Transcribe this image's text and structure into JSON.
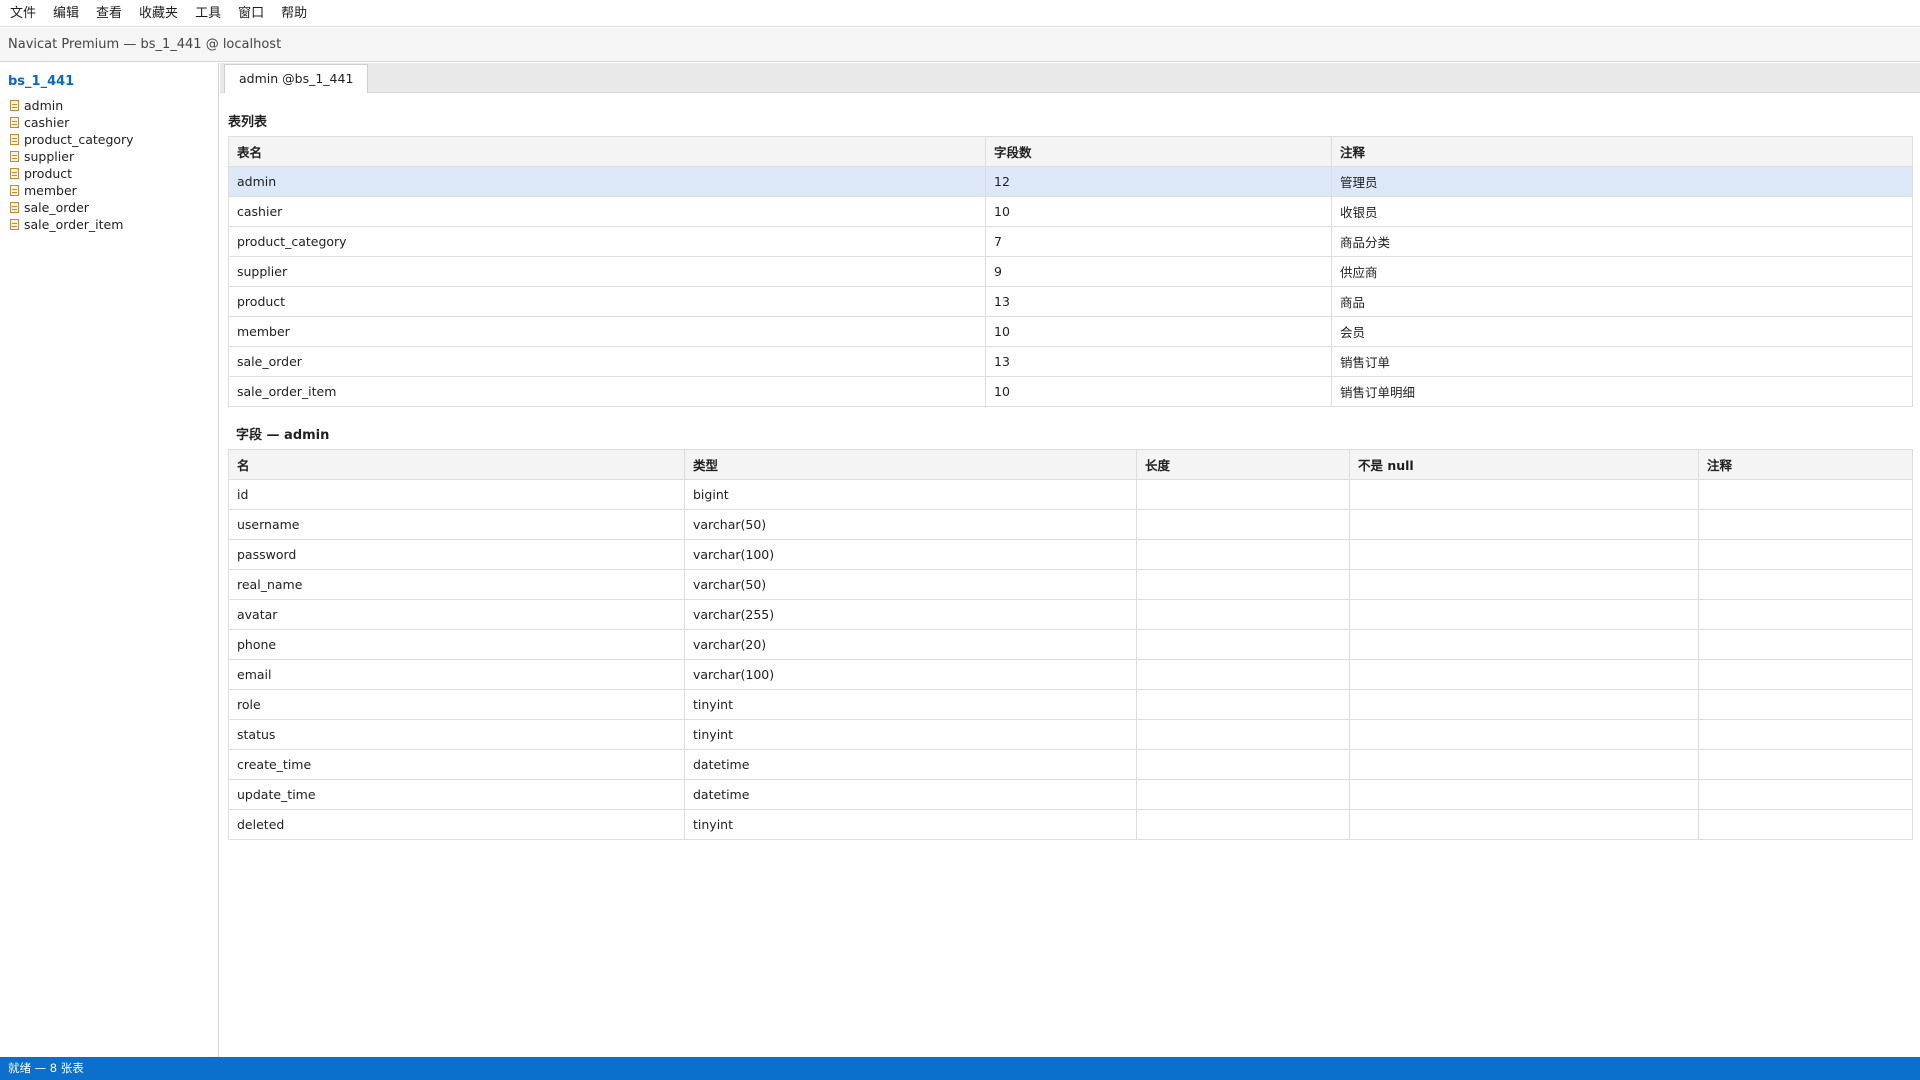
{
  "menubar": {
    "items": [
      "文件",
      "编辑",
      "查看",
      "收藏夹",
      "工具",
      "窗口",
      "帮助"
    ]
  },
  "window": {
    "title": "Navicat Premium — bs_1_441 @ localhost"
  },
  "sidebar": {
    "database": "bs_1_441",
    "tables": [
      "admin",
      "cashier",
      "product_category",
      "supplier",
      "product",
      "member",
      "sale_order",
      "sale_order_item"
    ]
  },
  "tabs": [
    {
      "label": "admin @bs_1_441",
      "active": true
    }
  ],
  "table_list": {
    "title": "表列表",
    "columns": [
      "表名",
      "字段数",
      "注释"
    ],
    "selected_row": 0,
    "rows": [
      [
        "admin",
        "12",
        "管理员"
      ],
      [
        "cashier",
        "10",
        "收银员"
      ],
      [
        "product_category",
        "7",
        "商品分类"
      ],
      [
        "supplier",
        "9",
        "供应商"
      ],
      [
        "product",
        "13",
        "商品"
      ],
      [
        "member",
        "10",
        "会员"
      ],
      [
        "sale_order",
        "13",
        "销售订单"
      ],
      [
        "sale_order_item",
        "10",
        "销售订单明细"
      ]
    ]
  },
  "fields": {
    "title": "字段 — admin",
    "columns": [
      "名",
      "类型",
      "长度",
      "不是 null",
      "注释"
    ],
    "rows": [
      [
        "id",
        "bigint",
        "",
        "",
        ""
      ],
      [
        "username",
        "varchar(50)",
        "",
        "",
        ""
      ],
      [
        "password",
        "varchar(100)",
        "",
        "",
        ""
      ],
      [
        "real_name",
        "varchar(50)",
        "",
        "",
        ""
      ],
      [
        "avatar",
        "varchar(255)",
        "",
        "",
        ""
      ],
      [
        "phone",
        "varchar(20)",
        "",
        "",
        ""
      ],
      [
        "email",
        "varchar(100)",
        "",
        "",
        ""
      ],
      [
        "role",
        "tinyint",
        "",
        "",
        ""
      ],
      [
        "status",
        "tinyint",
        "",
        "",
        ""
      ],
      [
        "create_time",
        "datetime",
        "",
        "",
        ""
      ],
      [
        "update_time",
        "datetime",
        "",
        "",
        ""
      ],
      [
        "deleted",
        "tinyint",
        "",
        "",
        ""
      ]
    ]
  },
  "statusbar": {
    "text": "就绪 — 8 张表"
  },
  "colors": {
    "accent": "#0b6fcc",
    "selection": "#dce8f7",
    "db_link": "#0a66c8"
  }
}
